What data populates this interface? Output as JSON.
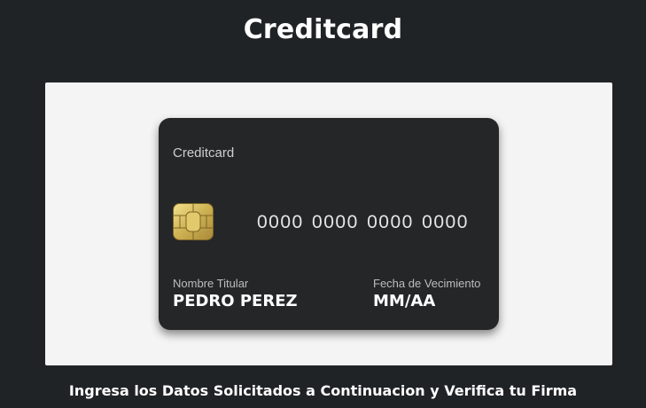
{
  "page": {
    "title": "Creditcard",
    "instructions": "Ingresa los Datos Solicitados a Continuacion y Verifica tu Firma"
  },
  "card": {
    "brand": "Creditcard",
    "number": "0000 0000 0000 0000",
    "holder_label": "Nombre Titular",
    "holder_name": "PEDRO PEREZ",
    "expiry_label": "Fecha de Vecimiento",
    "expiry_value": "MM/AA",
    "chip_icon": "chip-icon"
  },
  "colors": {
    "background": "#202326",
    "panel": "#f4f4f4",
    "card": "#252628",
    "chip_gold": "#d9c36a"
  }
}
